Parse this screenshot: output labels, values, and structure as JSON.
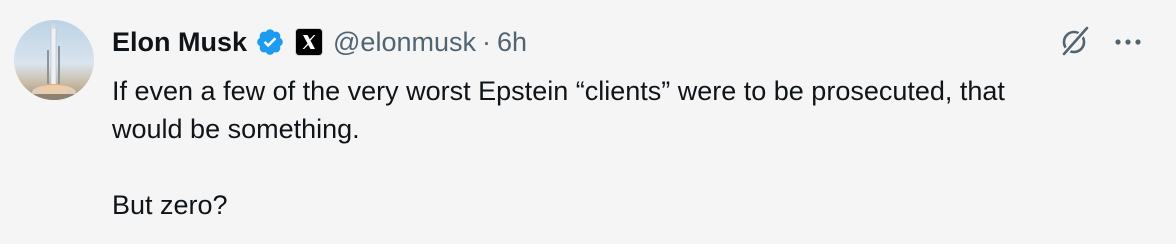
{
  "tweet": {
    "author": {
      "name": "Elon Musk",
      "handle": "@elonmusk",
      "verified": true,
      "affiliation_badge": "x-logo-icon"
    },
    "separator": "·",
    "time": "6h",
    "lines": [
      "If even a few of the very worst Epstein “clients” were to be prosecuted, that",
      "would be something.",
      "But zero?"
    ],
    "actions": {
      "grok_icon": "grok-icon",
      "more_icon": "more-icon"
    }
  },
  "colors": {
    "background": "#f5f5f5",
    "text": "#0f1419",
    "secondary": "#536471",
    "verified": "#1d9bf0"
  }
}
